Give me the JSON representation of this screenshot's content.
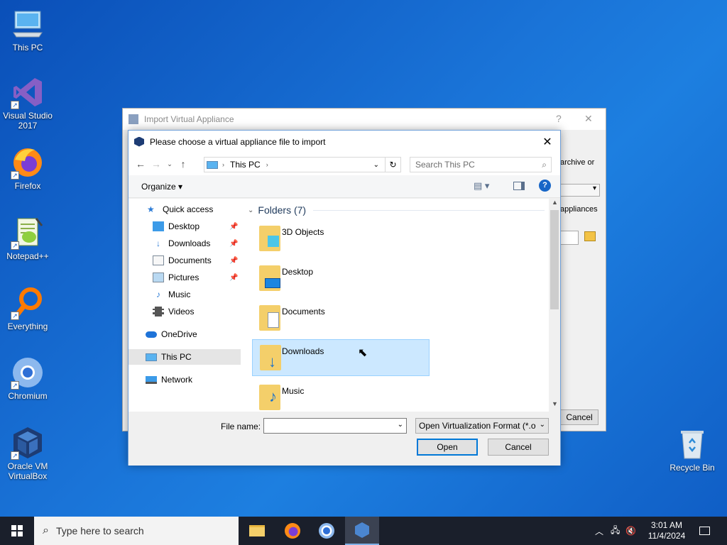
{
  "desktop": {
    "icons": [
      {
        "label": "This PC",
        "icon": "computer-icon"
      },
      {
        "label": "Visual Studio 2017",
        "icon": "visual-studio-icon"
      },
      {
        "label": "Firefox",
        "icon": "firefox-icon"
      },
      {
        "label": "Notepad++",
        "icon": "notepadpp-icon"
      },
      {
        "label": "Everything",
        "icon": "everything-icon"
      },
      {
        "label": "Chromium",
        "icon": "chromium-icon"
      },
      {
        "label": "Oracle VM VirtualBox",
        "icon": "virtualbox-icon"
      },
      {
        "label": "Recycle Bin",
        "icon": "recycle-bin-icon"
      }
    ]
  },
  "back_window": {
    "title": "Import Virtual Appliance",
    "help": "?",
    "close": "✕",
    "text_archive": "archive or",
    "text_appliances": "appliances",
    "cancel_label": "Cancel"
  },
  "dialog": {
    "title": "Please choose a virtual appliance file to import",
    "close": "✕",
    "address": {
      "root": "This PC"
    },
    "search_placeholder": "Search This PC",
    "toolbar": {
      "organize": "Organize ▾"
    },
    "nav": {
      "quick_access": "Quick access",
      "items": [
        "Desktop",
        "Downloads",
        "Documents",
        "Pictures",
        "Music",
        "Videos"
      ],
      "onedrive": "OneDrive",
      "this_pc": "This PC",
      "network": "Network"
    },
    "content": {
      "group": "Folders (7)",
      "folders": [
        "3D Objects",
        "Desktop",
        "Documents",
        "Downloads",
        "Music"
      ],
      "selected": "Downloads"
    },
    "file_name_label": "File name:",
    "file_name_value": "",
    "filter": "Open Virtualization Format (*.o",
    "open_label": "Open",
    "cancel_label": "Cancel"
  },
  "taskbar": {
    "search_placeholder": "Type here to search",
    "time": "3:01 AM",
    "date": "11/4/2024"
  },
  "colors": {
    "accent": "#0078d7",
    "selection": "#cce8ff",
    "taskbar": "#1a1f2b"
  }
}
